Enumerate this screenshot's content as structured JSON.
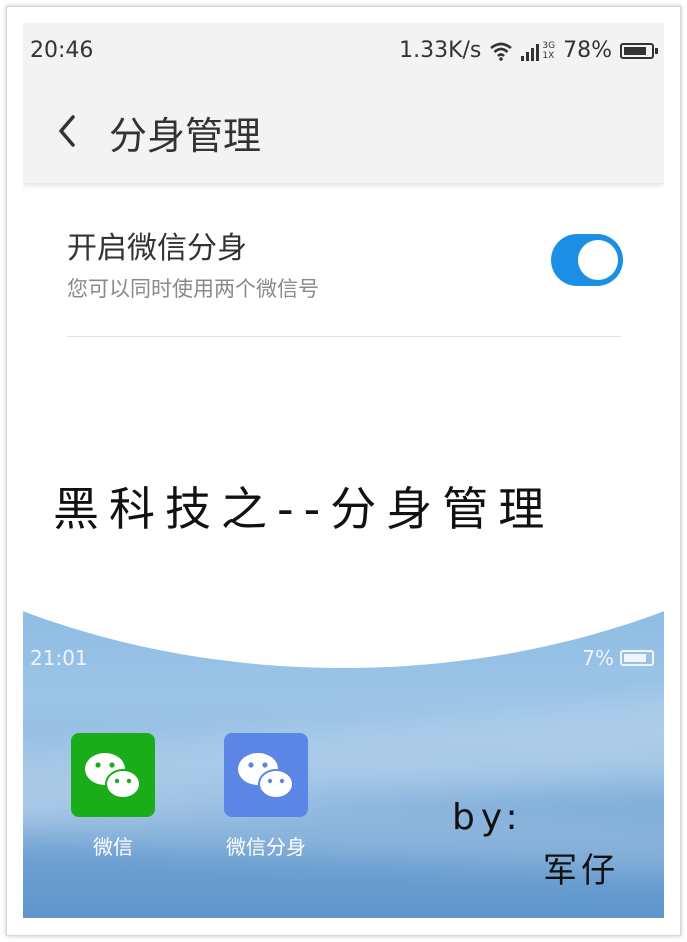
{
  "status": {
    "time": "20:46",
    "net_speed": "1.33K/s",
    "network_top": "3G",
    "network_bottom": "1X",
    "battery": "78%"
  },
  "appbar": {
    "title": "分身管理"
  },
  "setting": {
    "title": "开启微信分身",
    "subtitle": "您可以同时使用两个微信号",
    "toggle_on": true
  },
  "overlay": {
    "title": "黑科技之--分身管理"
  },
  "home": {
    "time": "21:01",
    "battery": "7%",
    "apps": [
      {
        "label": "微信",
        "icon": "wechat-icon",
        "color": "#1aad19"
      },
      {
        "label": "微信分身",
        "icon": "wechat-clone-icon",
        "color": "#5b86e5"
      }
    ]
  },
  "credit": {
    "by": "by:",
    "author": "军仔"
  },
  "colors": {
    "accent": "#1b8fe6",
    "wechat": "#1aad19",
    "clone": "#5b86e5"
  }
}
